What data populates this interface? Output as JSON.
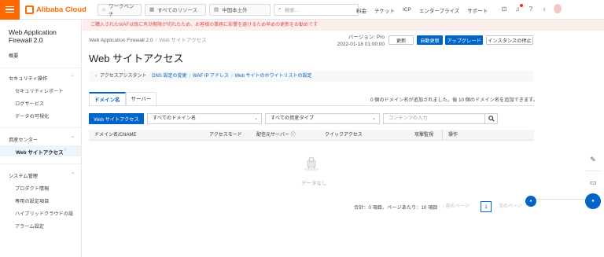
{
  "topbar": {
    "logo": "Alibaba Cloud",
    "workbench": "ワークベンチ",
    "resources": "すべてのリソース",
    "region": "中国本土外",
    "search_placeholder": "検索...",
    "links": [
      "料金",
      "チケット",
      "ICP",
      "エンタープライズ",
      "サポート"
    ]
  },
  "sidebar": {
    "title_line1": "Web Application",
    "title_line2": "Firewall 2.0",
    "overview": "概要",
    "section_security": "セキュリティ操作",
    "security_report": "セキュリティレポート",
    "log_service": "ログサービス",
    "data_visualization": "データの可視化",
    "section_asset": "資産センター",
    "web_access": "Web サイトアクセス",
    "section_system": "システム管理",
    "product_info": "プロダクト情報",
    "dedicated_settings": "専用の設定項目",
    "hybrid_cloud": "ハイブリッドクラウドの設",
    "alarm_settings": "アラーム設定"
  },
  "banner": "ご購入されたWAFは既に有効期限が切れたため、お客様の業務に影響を避けるため早めの更新をお勧めです",
  "breadcrumb": {
    "root": "Web Application Firewall 2.0",
    "sep": "/",
    "current": "Web サイトアクセス"
  },
  "version": {
    "label": "バージョン: Pro",
    "date": "2022-01-18 01:00:00"
  },
  "buttons": {
    "renew": "更新",
    "auto_renew": "自動更新",
    "upgrade": "アップグレード",
    "stop_instance": "インスタンスの停止"
  },
  "page_title": "Web サイトアクセス",
  "assistant": {
    "label": "アクセスアシスタント",
    "link1": "DNS 設定の変更",
    "link2": "WAF IP アドレス",
    "link3": "Web サイトのホワイトリストの設定"
  },
  "tabs": [
    "ドメイン名",
    "サーバー"
  ],
  "domain_count": "0 個のドメイン名が追加されました。後 10 個のドメイン名を追加できます。",
  "filters": {
    "add_button": "Web サイトアクセス",
    "domain_select": "すべてのドメイン名",
    "asset_select": "すべての資産タイプ",
    "content_placeholder": "コンテンツの入力"
  },
  "table": {
    "headers": [
      "ドメイン名/CNAME",
      "アクセスモード",
      "配信元サーバー",
      "クイックアクセス",
      "攻撃監視",
      "操作"
    ],
    "empty_text": "データなし"
  },
  "pagination": {
    "summary": "合計：0 項目、ページあたり：10 項目",
    "prev": "前のページ",
    "current": "1",
    "next": "次のページ"
  },
  "colors": {
    "brand_orange": "#ff6a00",
    "primary_blue": "#0064c8",
    "banner_text": "#d9534f"
  }
}
